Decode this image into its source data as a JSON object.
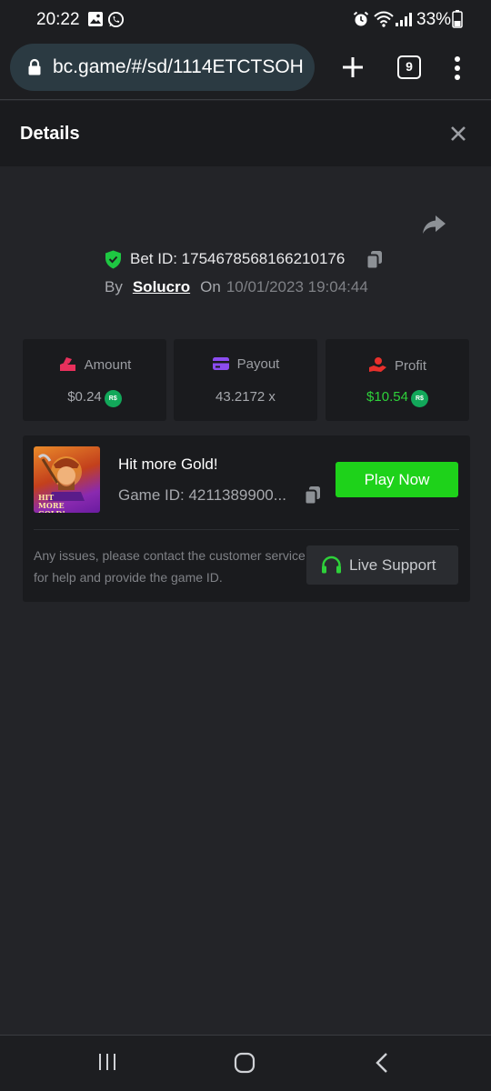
{
  "status_bar": {
    "time": "20:22",
    "battery": "33%",
    "icons": [
      "image-icon",
      "whatsapp-icon",
      "alarm-icon",
      "wifi-icon",
      "signal-icon",
      "battery-icon"
    ]
  },
  "browser": {
    "url": "bc.game/#/sd/1114ETCTSOH",
    "tab_count": "9"
  },
  "details": {
    "title": "Details"
  },
  "bet": {
    "bet_id": "Bet ID: 1754678568166210176",
    "by_label": "By",
    "user": "Solucro",
    "on_label": "On",
    "date": "10/01/2023 19:04:44"
  },
  "stats": {
    "amount": {
      "label": "Amount",
      "value": "$0.24",
      "currency": "R$"
    },
    "payout": {
      "label": "Payout",
      "value": "43.2172 x"
    },
    "profit": {
      "label": "Profit",
      "value": "$10.54",
      "currency": "R$"
    }
  },
  "game": {
    "name": "Hit more Gold!",
    "game_id": "Game ID: 4211389900...",
    "thumb_text": "HIT MORE GOLD!",
    "play_label": "Play Now",
    "issues_text": "Any issues, please contact the customer service for help and provide the game ID.",
    "support_label": "Live Support"
  },
  "colors": {
    "accent_green": "#1ed21a",
    "profit_green": "#2ed13a",
    "currency_badge": "#12a85a",
    "amount_icon": "#e8305c",
    "payout_icon": "#8b4cf0",
    "profit_icon": "#e8302c"
  }
}
